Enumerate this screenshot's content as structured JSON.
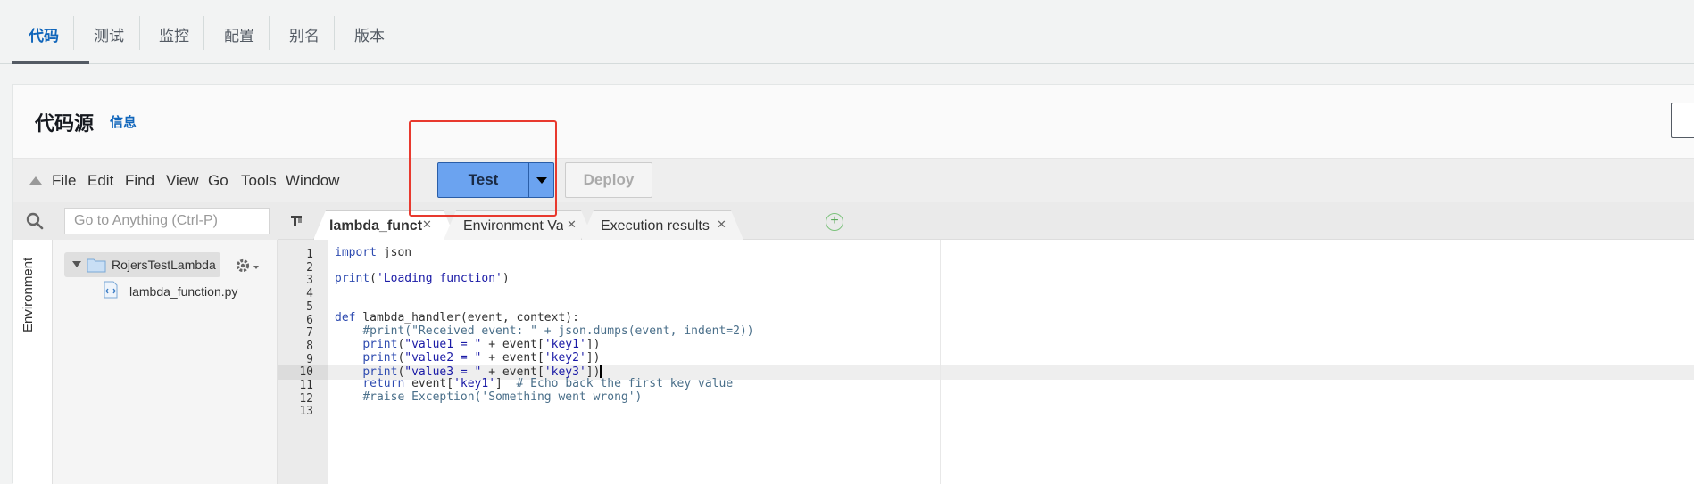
{
  "tabs": [
    {
      "label": "代码",
      "active": true
    },
    {
      "label": "测试",
      "active": false
    },
    {
      "label": "监控",
      "active": false
    },
    {
      "label": "配置",
      "active": false
    },
    {
      "label": "别名",
      "active": false
    },
    {
      "label": "版本",
      "active": false
    }
  ],
  "panel": {
    "title": "代码源",
    "info_link": "信息"
  },
  "menu": {
    "items": [
      "File",
      "Edit",
      "Find",
      "View",
      "Go",
      "Tools",
      "Window"
    ],
    "test_label": "Test",
    "deploy_label": "Deploy"
  },
  "sidebar": {
    "search_placeholder": "Go to Anything (Ctrl-P)",
    "environment_label": "Environment",
    "folder_name": "RojersTestLambda",
    "file_name": "lambda_function.py"
  },
  "editor_tabs": [
    {
      "label": "lambda_function",
      "active": true
    },
    {
      "label": "Environment Var",
      "active": false
    },
    {
      "label": "Execution results",
      "active": false
    }
  ],
  "code": {
    "active_line": 10,
    "lines": [
      "import json",
      "",
      "print('Loading function')",
      "",
      "",
      "def lambda_handler(event, context):",
      "    #print(\"Received event: \" + json.dumps(event, indent=2))",
      "    print(\"value1 = \" + event['key1'])",
      "    print(\"value2 = \" + event['key2'])",
      "    print(\"value3 = \" + event['key3'])",
      "    return event['key1']  # Echo back the first key value",
      "    #raise Exception('Something went wrong')",
      ""
    ]
  },
  "colors": {
    "accent": "#1166bb",
    "test_button": "#6ba3f0",
    "highlight_box": "#e8392e"
  }
}
